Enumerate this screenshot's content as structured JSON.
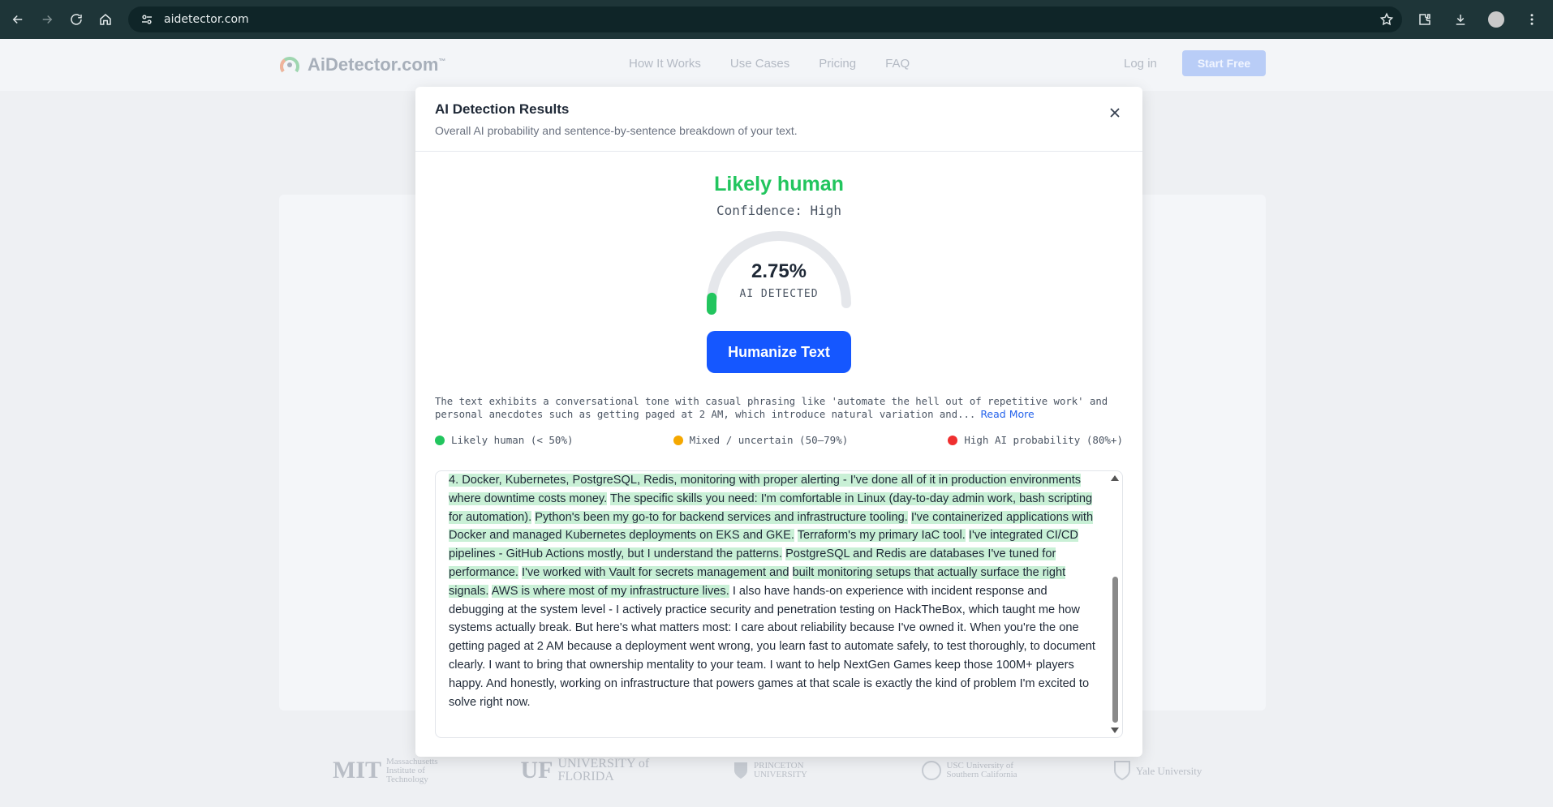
{
  "browser": {
    "url": "aidetector.com"
  },
  "site": {
    "logo_text": "AiDetector.com",
    "logo_tm": "™",
    "nav": [
      "How It Works",
      "Use Cases",
      "Pricing",
      "FAQ"
    ],
    "login": "Log in",
    "start_free": "Start Free",
    "partners": [
      {
        "big": "MIT",
        "small": "Massachusetts Institute of Technology"
      },
      {
        "big": "UF",
        "small": "UNIVERSITY of FLORIDA"
      },
      {
        "big": "",
        "small": "PRINCETON UNIVERSITY"
      },
      {
        "big": "",
        "small": "USC University of Southern California"
      },
      {
        "big": "",
        "small": "Yale University"
      }
    ]
  },
  "modal": {
    "title": "AI Detection Results",
    "subtitle": "Overall AI probability and sentence-by-sentence breakdown of your text.",
    "verdict": "Likely human",
    "confidence": "Confidence: High",
    "gauge": {
      "percent_text": "2.75%",
      "label": "AI DETECTED",
      "value": 2.75
    },
    "humanize_label": "Humanize Text",
    "analysis": "The text exhibits a conversational tone with casual phrasing like 'automate the hell out of repetitive work' and personal anecdotes such as getting paged at 2 AM, which introduce natural variation and...",
    "read_more": "Read More",
    "legend": [
      {
        "label": "Likely human (< 50%)",
        "color": "#22c55e"
      },
      {
        "label": "Mixed / uncertain (50–79%)",
        "color": "#f5a800"
      },
      {
        "label": "High AI probability (80%+)",
        "color": "#ef2f2f"
      }
    ],
    "sentences": [
      {
        "text": "4. Docker, Kubernetes, PostgreSQL, Redis, monitoring with proper alerting - I've done all of it in production environments where downtime costs money.",
        "highlight": true
      },
      {
        "text": "The specific skills you need: I'm comfortable in Linux (day-to-day admin work, bash scripting for automation).",
        "highlight": true
      },
      {
        "text": "Python's been my go-to for backend services and infrastructure tooling.",
        "highlight": true
      },
      {
        "text": "I've containerized applications with Docker and managed Kubernetes deployments on EKS and GKE.",
        "highlight": true
      },
      {
        "text": "Terraform's my primary IaC tool.",
        "highlight": true
      },
      {
        "text": "I've integrated CI/CD pipelines - GitHub Actions mostly, but I understand the patterns.",
        "highlight": true
      },
      {
        "text": "PostgreSQL and Redis are databases I've tuned for performance.",
        "highlight": true
      },
      {
        "text": "I've worked with Vault for secrets management and",
        "highlight": true
      },
      {
        "text": "built monitoring setups that actually surface the right signals.",
        "highlight": true
      },
      {
        "text": "AWS is where most of my infrastructure lives.",
        "highlight": true
      },
      {
        "text": "I also have hands-on experience with incident response and debugging at the system level - I actively practice security and penetration testing on HackTheBox, which taught me how systems actually break.",
        "highlight": false
      },
      {
        "text": "But here's what matters most: I care about reliability because I've owned it.",
        "highlight": false
      },
      {
        "text": "When you're the one getting paged at 2 AM because a deployment went wrong, you learn fast to automate safely, to test thoroughly, to document clearly.",
        "highlight": false
      },
      {
        "text": "I want to bring that ownership mentality to your team.",
        "highlight": false
      },
      {
        "text": "I want to help NextGen Games keep those 100M+ players happy.",
        "highlight": false
      },
      {
        "text": "And honestly, working on infrastructure that powers games at that scale is exactly the kind of problem I'm excited to solve right now.",
        "highlight": false
      }
    ]
  }
}
